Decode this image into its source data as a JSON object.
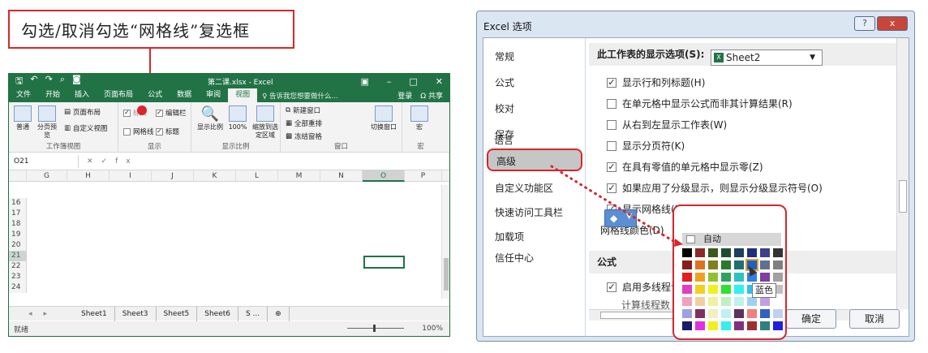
{
  "annotation": {
    "text": "勾选/取消勾选“网格线”复选框"
  },
  "excel": {
    "title": "第二课.xlsx - Excel",
    "qat_icons": [
      "save-icon",
      "undo-icon",
      "redo-icon",
      "print-preview-icon",
      "camera-icon"
    ],
    "menu_tabs": [
      "文件",
      "开始",
      "插入",
      "页面布局",
      "公式",
      "数据",
      "审阅",
      "视图"
    ],
    "active_tab": "视图",
    "tell_me": "♀ 告诉我您想要做什么...",
    "login": "登录",
    "share": "Ω 共享",
    "ribbon": {
      "view_group_label": "工作簿视图",
      "normal": "普通",
      "page_break": "分页预览",
      "page_layout": "页面布局",
      "custom_view": "自定义视图",
      "ruler": "标尺",
      "formula_bar": "编辑栏",
      "gridlines": "网格线",
      "headings": "标题",
      "show_group_label": "显示",
      "zoom": "显示比例",
      "zoom100": "100%",
      "zoom_selection": "缩放到选定区域",
      "zoom_group_label": "显示比例",
      "new_window": "新建窗口",
      "arrange_all": "全部重排",
      "freeze_panes": "冻结窗格",
      "switch_window": "切换窗口",
      "window_group_label": "窗口",
      "macro": "宏",
      "macro_group_label": "宏"
    },
    "namebox": "O21",
    "fx": "fx",
    "columns": [
      "G",
      "H",
      "I",
      "J",
      "K",
      "L",
      "M",
      "N",
      "O",
      "P"
    ],
    "selected_column": "O",
    "rows": [
      "16",
      "17",
      "18",
      "19",
      "20",
      "21",
      "22",
      "23",
      "24"
    ],
    "selected_row": "21",
    "sheets": [
      "Sheet1",
      "Sheet3",
      "Sheet5",
      "Sheet6",
      "S ...",
      "⊕"
    ],
    "status": "就绪",
    "zoom_level": "100%"
  },
  "dialog": {
    "title": "Excel 选项",
    "help_btn": "?",
    "close_btn": "x",
    "nav": [
      "常规",
      "公式",
      "校对",
      "保存",
      "语言",
      "高级",
      "自定义功能区",
      "快速访问工具栏",
      "加载项",
      "信任中心"
    ],
    "selected_nav": "高级",
    "section_title": "此工作表的显示选项(S):",
    "sheet_select": "Sheet2",
    "options": [
      {
        "label": "显示行和列标题(H)",
        "checked": true
      },
      {
        "label": "在单元格中显示公式而非其计算结果(R)",
        "checked": false
      },
      {
        "label": "从右到左显示工作表(W)",
        "checked": false
      },
      {
        "label": "显示分页符(K)",
        "checked": false
      },
      {
        "label": "在具有零值的单元格中显示零(Z)",
        "checked": true
      },
      {
        "label": "如果应用了分级显示，则显示分级显示符号(O)",
        "checked": true
      },
      {
        "label": "显示网格线(D)",
        "checked": true
      }
    ],
    "gridline_color_label": "网格线颜色(D)",
    "formula_section": "公式",
    "multithread_label": "启用多线程计",
    "calc_threads_label": "计算线程数",
    "ok": "确定",
    "cancel": "取消",
    "picker": {
      "auto_label": "自动",
      "tooltip": "蓝色",
      "colors": [
        "#000000",
        "#8b2a2a",
        "#3a5a1c",
        "#1f4e2f",
        "#1f3f5f",
        "#1f2f7f",
        "#3f3f8f",
        "#333333",
        "#8b1a1a",
        "#e07020",
        "#808020",
        "#2a7a2a",
        "#207070",
        "#2060c0",
        "#607090",
        "#808080",
        "#e02020",
        "#f0a020",
        "#90c030",
        "#30a060",
        "#30c0c0",
        "#3080e0",
        "#8040a0",
        "#a0a0a0",
        "#e040c0",
        "#f0d020",
        "#f0f020",
        "#30e030",
        "#30f0f0",
        "#30c0f0",
        "#a040a0",
        "#c0c0c0",
        "#f0a0c0",
        "#f0d0a0",
        "#f0f0a0",
        "#c0f0c0",
        "#c0f0f0",
        "#a0d0f0",
        "#c0a0e0",
        "#ffffff",
        "#a0a0e0",
        "#803060",
        "#f0f0c0",
        "#c0f0f0",
        "#603060",
        "#f08080",
        "#3060c0",
        "#c0d0f0",
        "#1a1a6a",
        "#e030e0",
        "#f0f020",
        "#30f0f0",
        "#803080",
        "#a03030",
        "#308080",
        "#2020e0"
      ]
    }
  }
}
